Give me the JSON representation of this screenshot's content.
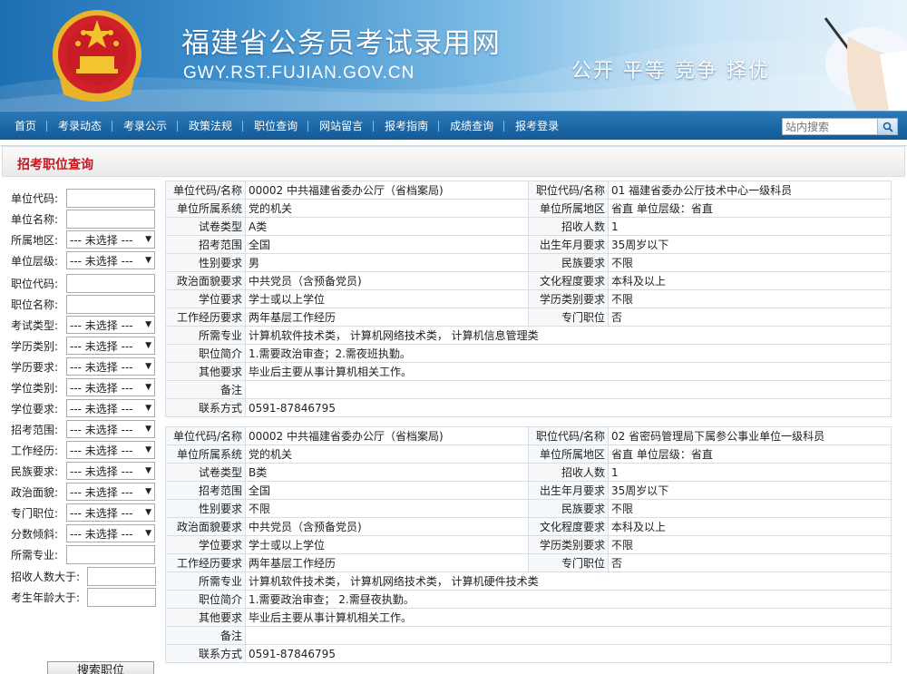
{
  "header": {
    "title": "福建省公务员考试录用网",
    "domain": "GWY.RST.FUJIAN.GOV.CN",
    "slogan": "公开 平等 竞争 择优"
  },
  "nav": {
    "items": [
      "首页",
      "考录动态",
      "考录公示",
      "政策法规",
      "职位查询",
      "网站留言",
      "报考指南",
      "成绩查询",
      "报考登录"
    ],
    "search_placeholder": "站内搜索"
  },
  "section": {
    "title": "招考职位查询"
  },
  "form": {
    "fields": [
      {
        "label": "单位代码:",
        "type": "input"
      },
      {
        "label": "单位名称:",
        "type": "input"
      },
      {
        "label": "所属地区:",
        "type": "select",
        "value": "--- 未选择 ---"
      },
      {
        "label": "单位层级:",
        "type": "select",
        "value": "--- 未选择 ---"
      },
      {
        "label": "职位代码:",
        "type": "input"
      },
      {
        "label": "职位名称:",
        "type": "input"
      },
      {
        "label": "考试类型:",
        "type": "select",
        "value": "--- 未选择 ---"
      },
      {
        "label": "学历类别:",
        "type": "select",
        "value": "--- 未选择 ---"
      },
      {
        "label": "学历要求:",
        "type": "select",
        "value": "--- 未选择 ---"
      },
      {
        "label": "学位类别:",
        "type": "select",
        "value": "--- 未选择 ---"
      },
      {
        "label": "学位要求:",
        "type": "select",
        "value": "--- 未选择 ---"
      },
      {
        "label": "招考范围:",
        "type": "select",
        "value": "--- 未选择 ---"
      },
      {
        "label": "工作经历:",
        "type": "select",
        "value": "--- 未选择 ---"
      },
      {
        "label": "民族要求:",
        "type": "select",
        "value": "--- 未选择 ---"
      },
      {
        "label": "政治面貌:",
        "type": "select",
        "value": "--- 未选择 ---"
      },
      {
        "label": "专门职位:",
        "type": "select",
        "value": "--- 未选择 ---"
      },
      {
        "label": "分数倾斜:",
        "type": "select",
        "value": "--- 未选择 ---"
      },
      {
        "label": "所需专业:",
        "type": "input"
      },
      {
        "label": "招收人数大于:",
        "type": "input"
      },
      {
        "label": "考生年龄大于:",
        "type": "input"
      }
    ],
    "submit_label": "搜索职位"
  },
  "jobs": [
    {
      "rows": [
        {
          "l1": "单位代码/名称",
          "v1": "00002 中共福建省委办公厅（省档案局)",
          "l2": "职位代码/名称",
          "v2": "01 福建省委办公厅技术中心一级科员"
        },
        {
          "l1": "单位所属系统",
          "v1": "党的机关",
          "l2": "单位所属地区",
          "v2": "省直    单位层级：省直"
        },
        {
          "l1": "试卷类型",
          "v1": "A类",
          "l2": "招收人数",
          "v2": "1"
        },
        {
          "l1": "招考范围",
          "v1": "全国",
          "l2": "出生年月要求",
          "v2": "35周岁以下"
        },
        {
          "l1": "性别要求",
          "v1": "男",
          "l2": "民族要求",
          "v2": "不限"
        },
        {
          "l1": "政治面貌要求",
          "v1": "中共党员（含预备党员)",
          "l2": "文化程度要求",
          "v2": "本科及以上"
        },
        {
          "l1": "学位要求",
          "v1": "学士或以上学位",
          "l2": "学历类别要求",
          "v2": "不限"
        },
        {
          "l1": "工作经历要求",
          "v1": "两年基层工作经历",
          "l2": "专门职位",
          "v2": "否"
        }
      ],
      "wide_rows": [
        {
          "l": "所需专业",
          "v": "计算机软件技术类， 计算机网络技术类， 计算机信息管理类"
        },
        {
          "l": "职位简介",
          "v": "1.需要政治审查；2.需夜班执勤。"
        },
        {
          "l": "其他要求",
          "v": "毕业后主要从事计算机相关工作。"
        },
        {
          "l": "备注",
          "v": ""
        },
        {
          "l": "联系方式",
          "v": "0591-87846795"
        }
      ]
    },
    {
      "rows": [
        {
          "l1": "单位代码/名称",
          "v1": "00002 中共福建省委办公厅（省档案局)",
          "l2": "职位代码/名称",
          "v2": "02 省密码管理局下属参公事业单位一级科员"
        },
        {
          "l1": "单位所属系统",
          "v1": "党的机关",
          "l2": "单位所属地区",
          "v2": "省直    单位层级：省直"
        },
        {
          "l1": "试卷类型",
          "v1": "B类",
          "l2": "招收人数",
          "v2": "1"
        },
        {
          "l1": "招考范围",
          "v1": "全国",
          "l2": "出生年月要求",
          "v2": "35周岁以下"
        },
        {
          "l1": "性别要求",
          "v1": "不限",
          "l2": "民族要求",
          "v2": "不限"
        },
        {
          "l1": "政治面貌要求",
          "v1": "中共党员（含预备党员)",
          "l2": "文化程度要求",
          "v2": "本科及以上"
        },
        {
          "l1": "学位要求",
          "v1": "学士或以上学位",
          "l2": "学历类别要求",
          "v2": "不限"
        },
        {
          "l1": "工作经历要求",
          "v1": "两年基层工作经历",
          "l2": "专门职位",
          "v2": "否"
        }
      ],
      "wide_rows": [
        {
          "l": "所需专业",
          "v": "计算机软件技术类， 计算机网络技术类， 计算机硬件技术类"
        },
        {
          "l": "职位简介",
          "v": "1.需要政治审查； 2.需昼夜执勤。"
        },
        {
          "l": "其他要求",
          "v": "毕业后主要从事计算机相关工作。"
        },
        {
          "l": "备注",
          "v": ""
        },
        {
          "l": "联系方式",
          "v": "0591-87846795"
        }
      ]
    }
  ]
}
